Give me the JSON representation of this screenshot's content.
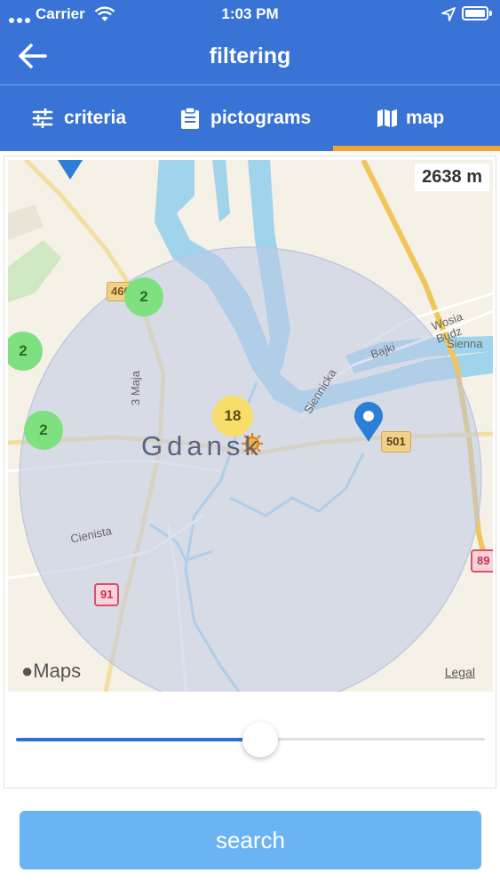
{
  "status_bar": {
    "carrier": "Carrier",
    "time": "1:03 PM"
  },
  "header": {
    "title": "filtering"
  },
  "tabs": [
    {
      "label": "criteria",
      "icon": "sliders-icon"
    },
    {
      "label": "pictograms",
      "icon": "clipboard-icon"
    },
    {
      "label": "map",
      "icon": "map-icon",
      "active": true
    }
  ],
  "map": {
    "distance": "2638 m",
    "city_label": "Gdansk",
    "attribution": "Maps",
    "legal": "Legal",
    "streets": [
      "3 Maja",
      "Cienista",
      "Siennicka",
      "Bajki",
      "Sienna",
      "Wosia Budz"
    ],
    "road_badges": [
      "466",
      "501",
      "91",
      "89"
    ],
    "clusters": [
      {
        "count": "2",
        "color": "#7fe07f"
      },
      {
        "count": "2",
        "color": "#7fe07f"
      },
      {
        "count": "2",
        "color": "#7fe07f"
      },
      {
        "count": "18",
        "color": "#f7de6a"
      }
    ]
  },
  "slider": {
    "value": 0.52
  },
  "search": {
    "label": "search"
  },
  "colors": {
    "header": "#3a73d6",
    "accent": "#f2a531",
    "slider": "#2b6fd6",
    "button": "#6ab4f4"
  }
}
